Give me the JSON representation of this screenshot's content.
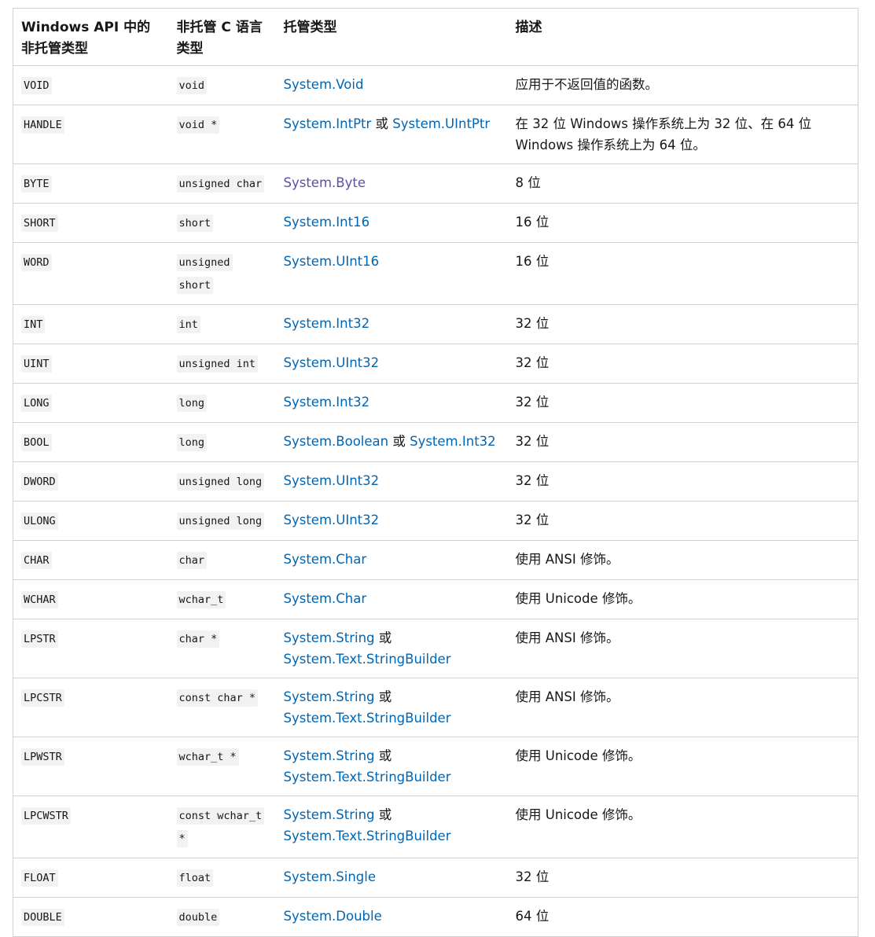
{
  "headers": [
    "Windows API 中的非托管类型",
    "非托管 C 语言类型",
    "托管类型",
    "描述"
  ],
  "link_color": "#0065b3",
  "visited_link_color": "#5f4ea8",
  "or_word": "或",
  "rows": [
    {
      "win": "VOID",
      "c": "void",
      "managed": [
        "System.Void"
      ],
      "desc": "应用于不返回值的函数。"
    },
    {
      "win": "HANDLE",
      "c": "void *",
      "managed": [
        "System.IntPtr",
        "System.UIntPtr"
      ],
      "desc": "在 32 位 Windows 操作系统上为 32 位、在 64 位 Windows 操作系统上为 64 位。"
    },
    {
      "win": "BYTE",
      "c": "unsigned char",
      "managed": [
        "System.Byte"
      ],
      "desc": "8 位",
      "visited": true
    },
    {
      "win": "SHORT",
      "c": "short",
      "managed": [
        "System.Int16"
      ],
      "desc": "16 位"
    },
    {
      "win": "WORD",
      "c": "unsigned short",
      "managed": [
        "System.UInt16"
      ],
      "desc": "16 位"
    },
    {
      "win": "INT",
      "c": "int",
      "managed": [
        "System.Int32"
      ],
      "desc": "32 位"
    },
    {
      "win": "UINT",
      "c": "unsigned int",
      "managed": [
        "System.UInt32"
      ],
      "desc": "32 位"
    },
    {
      "win": "LONG",
      "c": "long",
      "managed": [
        "System.Int32"
      ],
      "desc": "32 位"
    },
    {
      "win": "BOOL",
      "c": "long",
      "managed": [
        "System.Boolean",
        "System.Int32"
      ],
      "desc": "32 位"
    },
    {
      "win": "DWORD",
      "c": "unsigned long",
      "managed": [
        "System.UInt32"
      ],
      "desc": "32 位"
    },
    {
      "win": "ULONG",
      "c": "unsigned long",
      "managed": [
        "System.UInt32"
      ],
      "desc": "32 位"
    },
    {
      "win": "CHAR",
      "c": "char",
      "managed": [
        "System.Char"
      ],
      "desc": "使用 ANSI 修饰。"
    },
    {
      "win": "WCHAR",
      "c": "wchar_t",
      "managed": [
        "System.Char"
      ],
      "desc": "使用 Unicode 修饰。"
    },
    {
      "win": "LPSTR",
      "c": "char *",
      "managed": [
        "System.String",
        "System.Text.StringBuilder"
      ],
      "desc": "使用 ANSI 修饰。"
    },
    {
      "win": "LPCSTR",
      "c": "const char *",
      "managed": [
        "System.String",
        "System.Text.StringBuilder"
      ],
      "desc": "使用 ANSI 修饰。"
    },
    {
      "win": "LPWSTR",
      "c": "wchar_t *",
      "managed": [
        "System.String",
        "System.Text.StringBuilder"
      ],
      "desc": "使用 Unicode 修饰。"
    },
    {
      "win": "LPCWSTR",
      "c": "const wchar_t *",
      "managed": [
        "System.String",
        "System.Text.StringBuilder"
      ],
      "desc": "使用 Unicode 修饰。"
    },
    {
      "win": "FLOAT",
      "c": "float",
      "managed": [
        "System.Single"
      ],
      "desc": "32 位"
    },
    {
      "win": "DOUBLE",
      "c": "double",
      "managed": [
        "System.Double"
      ],
      "desc": "64 位"
    }
  ]
}
